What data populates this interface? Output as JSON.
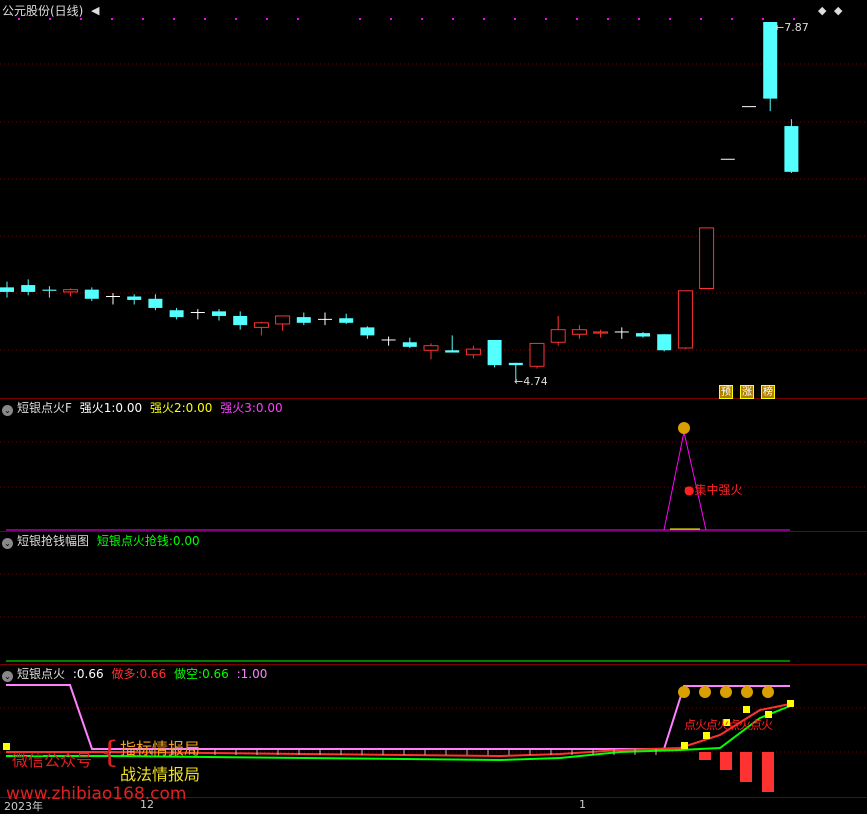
{
  "main": {
    "title": "公元股份(日线)",
    "high_label": "7.87",
    "low_label": "4.74",
    "badges": [
      "预",
      "涨",
      "榜"
    ],
    "nav_left": "◀",
    "nav_right": "◆",
    "nav_close": "◆"
  },
  "panel1": {
    "name": "短银点火F",
    "v1_label": "强火1:",
    "v1": "0.00",
    "v2_label": "强火2:",
    "v2": "0.00",
    "v3_label": "强火3:",
    "v3": "0.00",
    "annot": "●集中强火"
  },
  "panel2": {
    "name": "短银抢钱幅图",
    "v1_label": "短银点火抢钱:",
    "v1": "0.00"
  },
  "panel3": {
    "name": "短银点火",
    "v0_label": ":",
    "v0": "0.66",
    "v1_label": "做多:",
    "v1": "0.66",
    "v2_label": "做空:",
    "v2": "0.66",
    "v3_label": ":",
    "v3": "1.00",
    "annot": "点火点火点火点火"
  },
  "watermark": {
    "wechat": "微信公众号",
    "brace": "{",
    "line1": "指标情报局",
    "line2": "战法情报局",
    "url": "www.zhibiao168.com"
  },
  "xaxis": {
    "labels": [
      "2023年",
      "12",
      "1"
    ]
  },
  "colors": {
    "up": "#ff3232",
    "down": "#54ffff",
    "flat": "#ffffff",
    "grid": "#7a0000",
    "magenta": "#ff00ff",
    "green": "#00ff00",
    "yellow": "#ffff00"
  },
  "chart_data": {
    "type": "candlestick",
    "series": [
      {
        "o": 5.55,
        "h": 5.6,
        "l": 5.46,
        "c": 5.51
      },
      {
        "o": 5.57,
        "h": 5.62,
        "l": 5.48,
        "c": 5.51
      },
      {
        "o": 5.53,
        "h": 5.56,
        "l": 5.46,
        "c": 5.52
      },
      {
        "o": 5.51,
        "h": 5.54,
        "l": 5.47,
        "c": 5.53
      },
      {
        "o": 5.53,
        "h": 5.55,
        "l": 5.43,
        "c": 5.45
      },
      {
        "o": 5.47,
        "h": 5.5,
        "l": 5.4,
        "c": 5.47
      },
      {
        "o": 5.47,
        "h": 5.49,
        "l": 5.4,
        "c": 5.44
      },
      {
        "o": 5.45,
        "h": 5.49,
        "l": 5.35,
        "c": 5.37
      },
      {
        "o": 5.35,
        "h": 5.37,
        "l": 5.27,
        "c": 5.29
      },
      {
        "o": 5.33,
        "h": 5.36,
        "l": 5.27,
        "c": 5.33
      },
      {
        "o": 5.34,
        "h": 5.36,
        "l": 5.26,
        "c": 5.3
      },
      {
        "o": 5.3,
        "h": 5.34,
        "l": 5.18,
        "c": 5.22
      },
      {
        "o": 5.2,
        "h": 5.25,
        "l": 5.13,
        "c": 5.24
      },
      {
        "o": 5.23,
        "h": 5.3,
        "l": 5.17,
        "c": 5.3
      },
      {
        "o": 5.29,
        "h": 5.33,
        "l": 5.22,
        "c": 5.24
      },
      {
        "o": 5.27,
        "h": 5.33,
        "l": 5.22,
        "c": 5.27
      },
      {
        "o": 5.28,
        "h": 5.32,
        "l": 5.23,
        "c": 5.24
      },
      {
        "o": 5.2,
        "h": 5.21,
        "l": 5.1,
        "c": 5.13
      },
      {
        "o": 5.09,
        "h": 5.12,
        "l": 5.04,
        "c": 5.09
      },
      {
        "o": 5.07,
        "h": 5.11,
        "l": 5.02,
        "c": 5.03
      },
      {
        "o": 5.0,
        "h": 5.06,
        "l": 4.92,
        "c": 5.04
      },
      {
        "o": 5.0,
        "h": 5.13,
        "l": 4.98,
        "c": 4.98
      },
      {
        "o": 4.96,
        "h": 5.04,
        "l": 4.93,
        "c": 5.01
      },
      {
        "o": 5.09,
        "h": 5.09,
        "l": 4.85,
        "c": 4.87
      },
      {
        "o": 4.89,
        "h": 4.89,
        "l": 4.74,
        "c": 4.87
      },
      {
        "o": 4.86,
        "h": 5.06,
        "l": 4.84,
        "c": 5.06
      },
      {
        "o": 5.07,
        "h": 5.3,
        "l": 5.04,
        "c": 5.18
      },
      {
        "o": 5.14,
        "h": 5.22,
        "l": 5.1,
        "c": 5.18
      },
      {
        "o": 5.15,
        "h": 5.18,
        "l": 5.11,
        "c": 5.16
      },
      {
        "o": 5.16,
        "h": 5.2,
        "l": 5.1,
        "c": 5.16
      },
      {
        "o": 5.15,
        "h": 5.16,
        "l": 5.11,
        "c": 5.12
      },
      {
        "o": 5.14,
        "h": 5.14,
        "l": 4.99,
        "c": 5.0
      },
      {
        "o": 5.02,
        "h": 5.52,
        "l": 5.01,
        "c": 5.52
      },
      {
        "o": 5.54,
        "h": 6.07,
        "l": 5.54,
        "c": 6.07
      },
      {
        "o": 6.67,
        "h": 6.67,
        "l": 6.67,
        "c": 6.67
      },
      {
        "o": 7.13,
        "h": 7.13,
        "l": 7.13,
        "c": 7.13
      },
      {
        "o": 7.87,
        "h": 7.87,
        "l": 7.09,
        "c": 7.2
      },
      {
        "o": 6.96,
        "h": 7.02,
        "l": 6.55,
        "c": 6.56
      }
    ]
  }
}
